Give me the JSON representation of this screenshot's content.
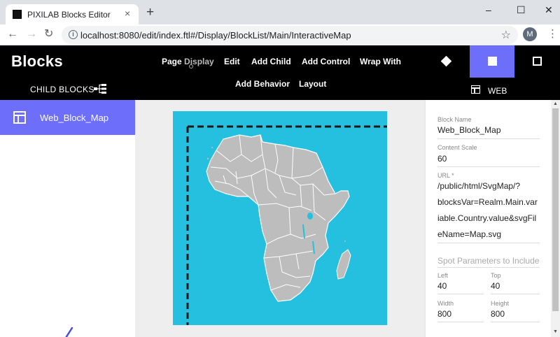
{
  "browser": {
    "tab_title": "PIXILAB Blocks Editor",
    "tab_close": "×",
    "new_tab": "+",
    "url": "localhost:8080/edit/index.ftl#/Display/BlockList/Main/InteractiveMap",
    "avatar_initial": "M",
    "win_min": "–",
    "win_max": "☐",
    "win_close": "✕",
    "back": "←",
    "forward": "→",
    "reload": "↻",
    "star": "☆",
    "menu": "⋮"
  },
  "app": {
    "logo": "Blocks",
    "menu": {
      "page": "Page",
      "display": "Display",
      "edit": "Edit",
      "add_child": "Add Child",
      "add_control": "Add Control",
      "wrap_with": "Wrap With",
      "add_behavior": "Add Behavior",
      "layout": "Layout"
    },
    "child_blocks_label": "CHILD BLOCKS",
    "web_label": "WEB",
    "accent_color": "#6d6ffb"
  },
  "tree": {
    "items": [
      {
        "label": "Web_Block_Map",
        "selected": true
      }
    ]
  },
  "canvas": {
    "map_background": "#25bfdf",
    "land_color": "#bdbdbd"
  },
  "properties": {
    "block_name_label": "Block Name",
    "block_name_value": "Web_Block_Map",
    "content_scale_label": "Content Scale",
    "content_scale_value": "60",
    "url_label": "URL *",
    "url_lines": [
      "/public/html/SvgMap/?",
      "blocksVar=Realm.Main.var",
      "iable.Country.value&svgFil",
      "eName=Map.svg"
    ],
    "spot_params_placeholder": "Spot Parameters to Include",
    "left_label": "Left",
    "left_value": "40",
    "top_label": "Top",
    "top_value": "40",
    "width_label": "Width",
    "width_value": "800",
    "height_label": "Height",
    "height_value": "800"
  }
}
